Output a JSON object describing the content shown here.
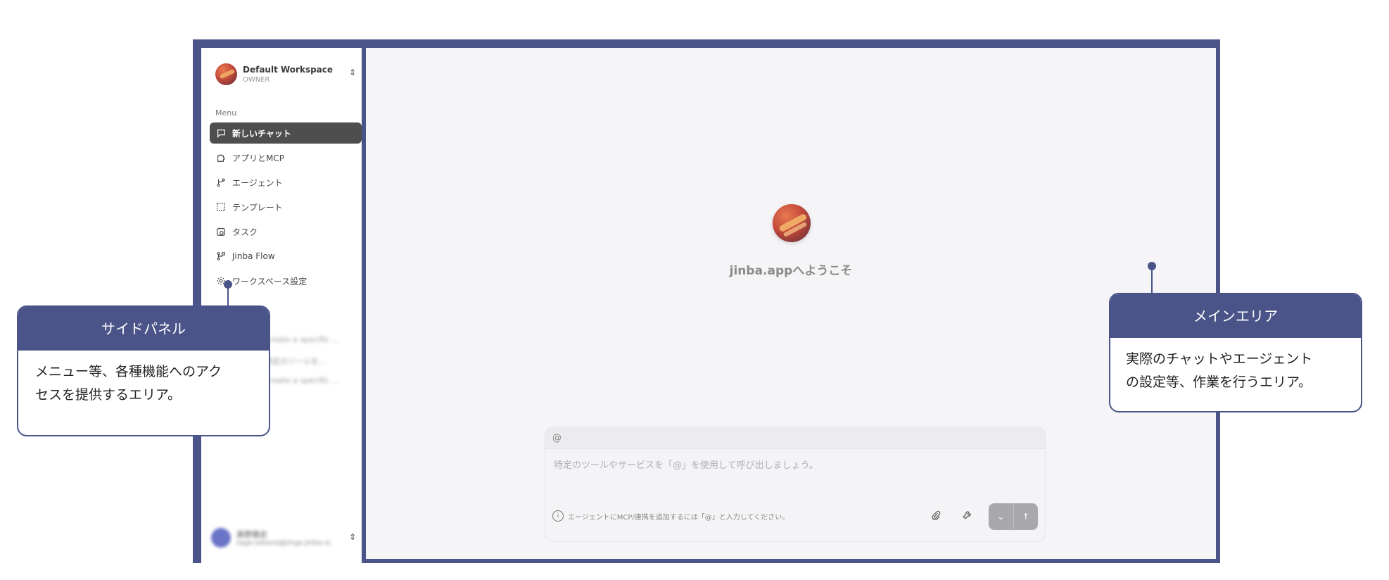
{
  "sidebar": {
    "workspace": {
      "name": "Default Workspace",
      "role": "OWNER"
    },
    "menu_label": "Menu",
    "items": [
      {
        "label": "新しいチャット",
        "icon": "chat-icon",
        "active": true
      },
      {
        "label": "アプリとMCP",
        "icon": "puzzle-icon"
      },
      {
        "label": "エージェント",
        "icon": "branch-icon"
      },
      {
        "label": "テンプレート",
        "icon": "template-icon"
      },
      {
        "label": "タスク",
        "icon": "clock-icon"
      },
      {
        "label": "Jinba Flow",
        "icon": "flow-icon"
      },
      {
        "label": "ワークスペース設定",
        "icon": "gear-icon"
      }
    ],
    "history": [
      "Create a specific ...",
      "特定のツールを...",
      "Create a specific ..."
    ],
    "user": {
      "name": "髙野雅史",
      "email": "taga.takano@jinga.jinba.io"
    }
  },
  "main": {
    "welcome": "jinba.appへようこそ",
    "composer": {
      "mention": "@",
      "placeholder": "特定のツールやサービスを「@」を使用して呼び出しましょう。",
      "hint": "エージェントにMCP/連携を追加するには「@」と入力してください。"
    }
  },
  "callouts": {
    "side": {
      "title": "サイドパネル",
      "body_line1": "メニュー等、各種機能へのアク",
      "body_line2": "セスを提供するエリア。"
    },
    "main": {
      "title": "メインエリア",
      "body_line1": "実際のチャットやエージェント",
      "body_line2": "の設定等、作業を行うエリア。"
    }
  },
  "colors": {
    "frame": "#4a5488",
    "active_nav": "#4e4e4e",
    "main_bg": "#f5f5f8"
  }
}
